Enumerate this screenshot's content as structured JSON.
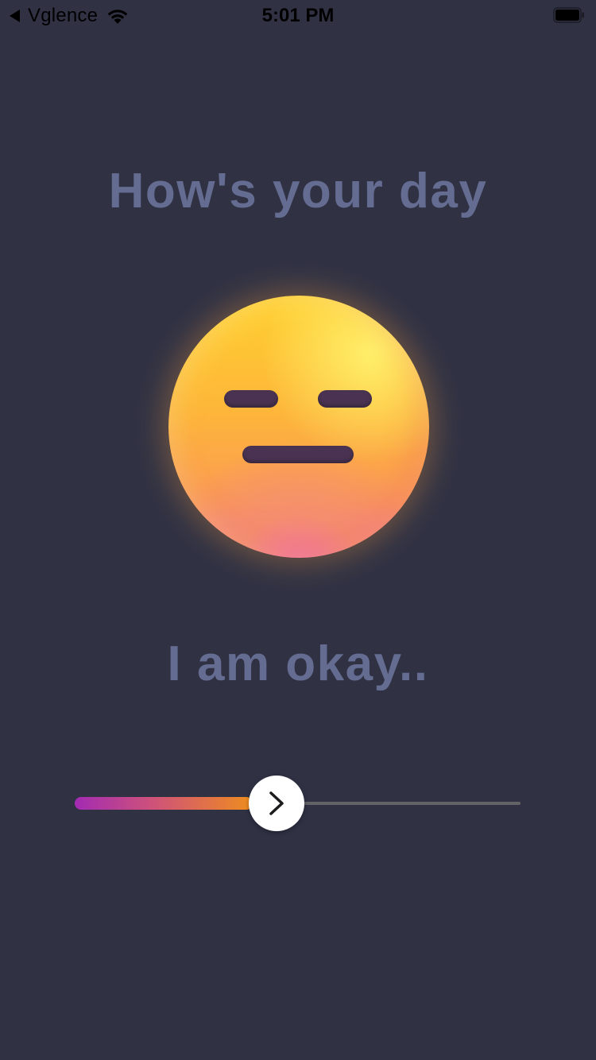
{
  "status_bar": {
    "back_app_label": "Vglence",
    "time": "5:01 PM",
    "battery_level": 1.0,
    "icons": [
      "back-arrow-icon",
      "wifi-icon",
      "battery-icon"
    ]
  },
  "main": {
    "title": "How's your day",
    "emoji": "expressionless-face-emoji",
    "mood_text": "I am okay.."
  },
  "slider": {
    "value": 0.4,
    "thumb_icon": "chevron-right-icon",
    "colors": {
      "fill_start": "#a22bb3",
      "fill_mid": "#cf5378",
      "fill_end": "#ef8d1e",
      "track": "#626366",
      "thumb": "#ffffff"
    }
  },
  "colors": {
    "background": "#303244",
    "text": "#646c91"
  }
}
